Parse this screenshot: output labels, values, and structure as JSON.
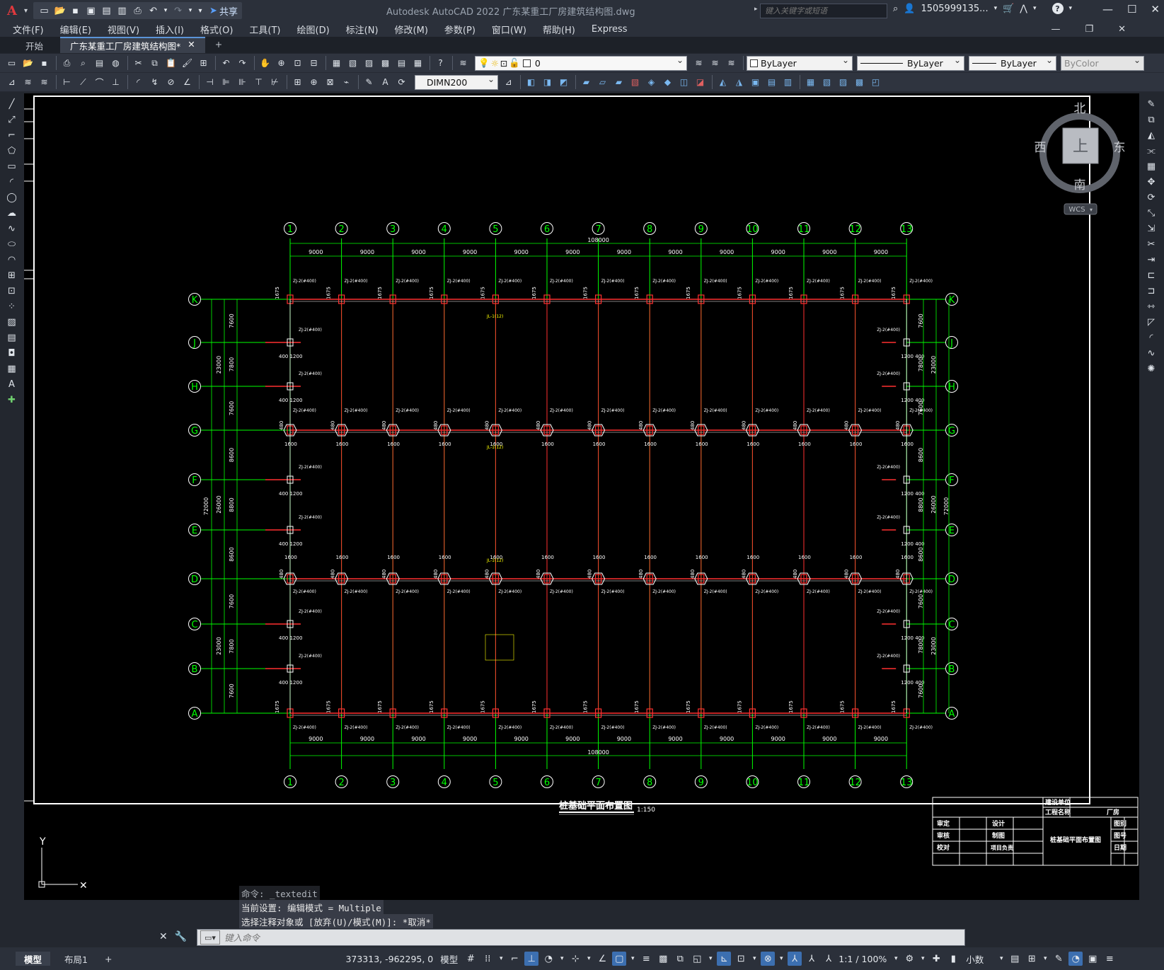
{
  "app": {
    "window_title": "Autodesk AutoCAD 2022    广东某重工厂房建筑结构图.dwg",
    "share_label": "共享",
    "search_placeholder": "键入关键字或短语",
    "user_name": "1505999135...",
    "logo": "A"
  },
  "menu": [
    "文件(F)",
    "编辑(E)",
    "视图(V)",
    "插入(I)",
    "格式(O)",
    "工具(T)",
    "绘图(D)",
    "标注(N)",
    "修改(M)",
    "参数(P)",
    "窗口(W)",
    "帮助(H)",
    "Express"
  ],
  "doc_tabs": {
    "start": "开始",
    "active": "广东某重工厂房建筑结构图*",
    "add": "+"
  },
  "properties": {
    "layer": "0",
    "color": "ByLayer",
    "linetype": "ByLayer",
    "lineweight": "ByLayer",
    "plotstyle": "ByColor",
    "dimstyle": "DIMN200"
  },
  "viewcube": {
    "north": "北",
    "south": "南",
    "east": "东",
    "west": "西",
    "top": "上",
    "wcs": "WCS"
  },
  "drawing": {
    "title": "桩基础平面布置图",
    "scale": "1:150",
    "columns": [
      "1",
      "2",
      "3",
      "4",
      "5",
      "6",
      "7",
      "8",
      "9",
      "10",
      "11",
      "12",
      "13"
    ],
    "rows": [
      "K",
      "J",
      "H",
      "G",
      "F",
      "E",
      "D",
      "C",
      "B",
      "A"
    ],
    "bay": "9000",
    "total_length": "108000",
    "left_dims_outer": "72000",
    "left_dims_mid": [
      "23000",
      "26000",
      "23000"
    ],
    "row_spacing": [
      "7600",
      "7800",
      "7600",
      "8600",
      "8800",
      "8600",
      "7600",
      "7800",
      "7600"
    ],
    "titleblock": {
      "client": "建设单位",
      "project": "工程名称",
      "plant": "厂房",
      "check": "审定",
      "design": "设计",
      "audit": "审核",
      "draw": "制图",
      "proof": "校对",
      "lead": "项目负责",
      "sheet_title": "桩基础平面布置图",
      "no": "图别",
      "num": "图号",
      "date": "日期"
    }
  },
  "command": {
    "history": [
      "命令: _textedit",
      "当前设置: 编辑模式 = Multiple",
      "选择注释对象或 [放弃(U)/模式(M)]: *取消*"
    ],
    "prompt_placeholder": "键入命令"
  },
  "status": {
    "model_tab": "模型",
    "layout_tab": "布局1",
    "add_tab": "+",
    "coords": "373313, -962295, 0",
    "space": "模型",
    "scale": "1:1 / 100%",
    "units": "小数"
  }
}
